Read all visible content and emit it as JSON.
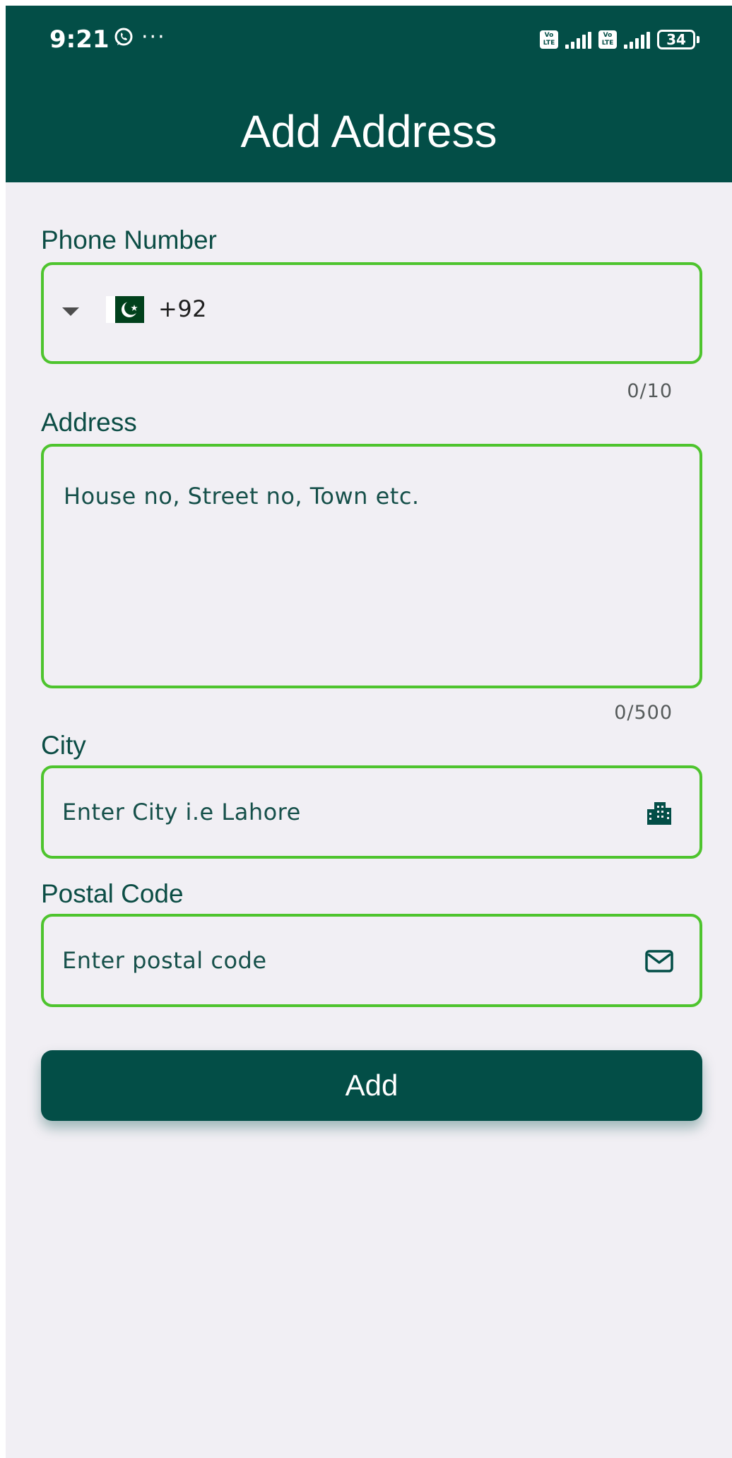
{
  "status_bar": {
    "time": "9:21",
    "more": "···",
    "battery": "34",
    "volte_label": "Vo LTE"
  },
  "header": {
    "title": "Add Address"
  },
  "form": {
    "phone": {
      "label": "Phone Number",
      "country_code": "+92",
      "country_flag": "pakistan-flag",
      "counter": "0/10"
    },
    "address": {
      "label": "Address",
      "placeholder": "House no, Street no, Town etc.",
      "counter": "0/500"
    },
    "city": {
      "label": "City",
      "placeholder": "Enter City i.e Lahore",
      "icon": "city-icon"
    },
    "postal": {
      "label": "Postal Code",
      "placeholder": "Enter postal code",
      "icon": "mail-icon"
    },
    "submit_label": "Add"
  },
  "colors": {
    "primary": "#034e47",
    "field_border": "#4ec42e",
    "background": "#f1eff4"
  }
}
